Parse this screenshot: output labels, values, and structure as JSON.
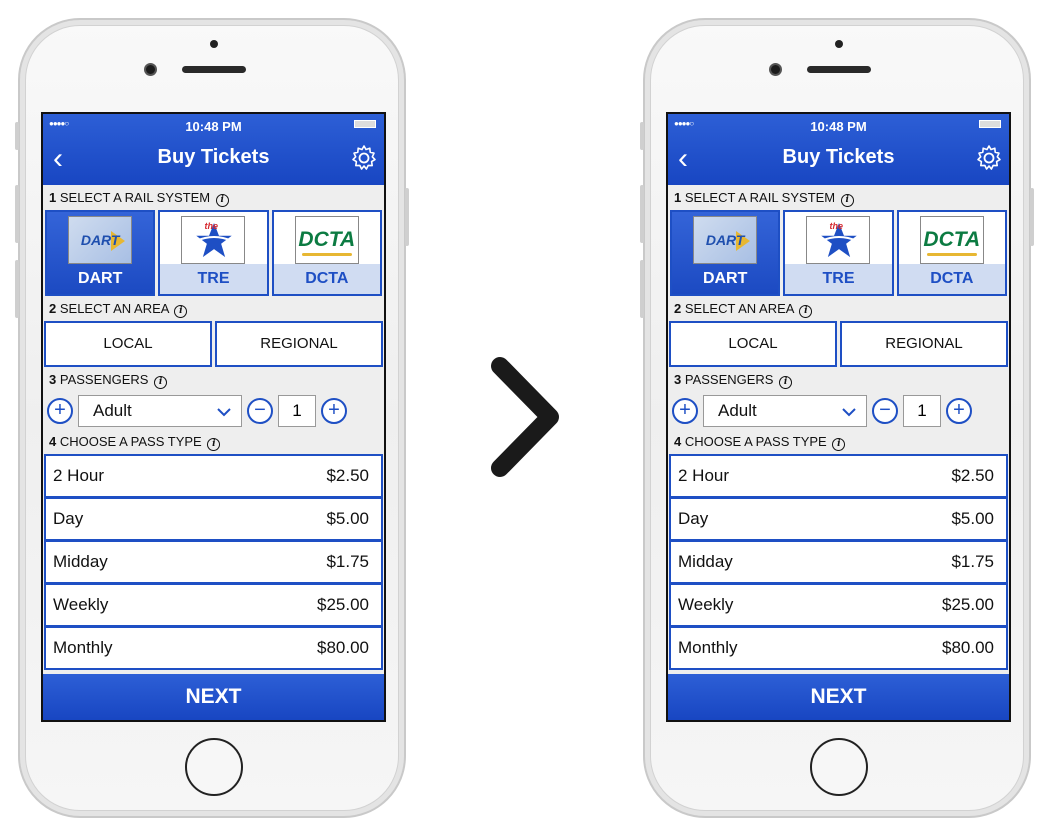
{
  "screens": [
    {
      "status": {
        "time": "10:48 PM",
        "signal": "●●●●○"
      },
      "header": {
        "title": "Buy Tickets",
        "back": "‹"
      },
      "sections": {
        "rail": {
          "num": "1",
          "label": "SELECT A RAIL SYSTEM"
        },
        "area": {
          "num": "2",
          "label": "SELECT AN AREA"
        },
        "passengers": {
          "num": "3",
          "label": "PASSENGERS"
        },
        "pass_type": {
          "num": "4",
          "label": "CHOOSE A PASS TYPE"
        }
      },
      "info_icon": "i",
      "rail_systems": [
        {
          "logo": "DART",
          "label": "DART",
          "selected": true
        },
        {
          "logo": "the",
          "label": "TRE",
          "selected": false
        },
        {
          "logo": "DCTA",
          "label": "DCTA",
          "selected": false
        }
      ],
      "areas": [
        "LOCAL",
        "REGIONAL"
      ],
      "passenger": {
        "minus_add": "+",
        "type": "Adult",
        "minus": "−",
        "qty": "1",
        "plus": "+"
      },
      "fares": [
        {
          "name": "2 Hour",
          "price": "$2.50"
        },
        {
          "name": "Day",
          "price": "$5.00"
        },
        {
          "name": "Midday",
          "price": "$1.75"
        },
        {
          "name": "Weekly",
          "price": "$25.00"
        },
        {
          "name": "Monthly",
          "price": "$80.00"
        }
      ],
      "next_label": "NEXT"
    },
    {
      "status": {
        "time": "10:48 PM",
        "signal": "●●●●○"
      },
      "header": {
        "title": "Buy Tickets",
        "back": "‹"
      },
      "sections": {
        "rail": {
          "num": "1",
          "label": "SELECT A RAIL SYSTEM"
        },
        "area": {
          "num": "2",
          "label": "SELECT AN AREA"
        },
        "passengers": {
          "num": "3",
          "label": "PASSENGERS"
        },
        "pass_type": {
          "num": "4",
          "label": "CHOOSE A PASS TYPE"
        }
      },
      "info_icon": "i",
      "rail_systems": [
        {
          "logo": "DART",
          "label": "DART",
          "selected": true
        },
        {
          "logo": "the",
          "label": "TRE",
          "selected": false
        },
        {
          "logo": "DCTA",
          "label": "DCTA",
          "selected": false
        }
      ],
      "areas": [
        "LOCAL",
        "REGIONAL"
      ],
      "passenger": {
        "minus_add": "+",
        "type": "Adult",
        "minus": "−",
        "qty": "1",
        "plus": "+"
      },
      "fares": [
        {
          "name": "2 Hour",
          "price": "$2.50"
        },
        {
          "name": "Day",
          "price": "$5.00"
        },
        {
          "name": "Midday",
          "price": "$1.75"
        },
        {
          "name": "Weekly",
          "price": "$25.00"
        },
        {
          "name": "Monthly",
          "price": "$80.00"
        }
      ],
      "next_label": "NEXT"
    }
  ],
  "colors": {
    "primary": "#1e4fc4",
    "header": "#1846c2",
    "dcta_green": "#0c7b42",
    "accent_gold": "#e7b732",
    "tre_red": "#d6282e"
  },
  "icons": {
    "back": "chevron-left-icon",
    "settings": "gear-icon",
    "add": "plus-circle-icon",
    "remove": "minus-circle-icon",
    "dropdown": "chevron-down-icon",
    "info": "info-icon",
    "transition": "chevron-right-icon"
  }
}
